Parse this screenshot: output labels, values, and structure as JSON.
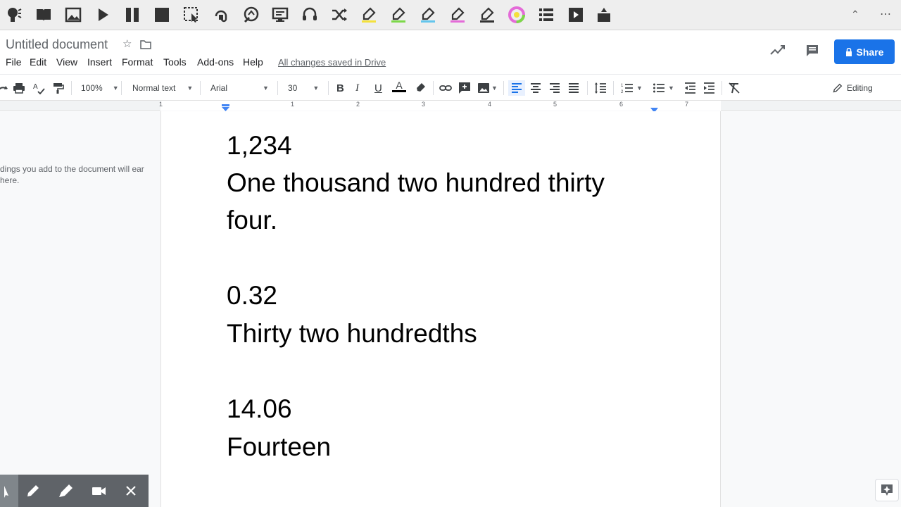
{
  "document": {
    "title": "Untitled document",
    "save_status": "All changes saved in Drive",
    "share_label": "Share",
    "mode_label": "Editing"
  },
  "menu": [
    "File",
    "Edit",
    "View",
    "Insert",
    "Format",
    "Tools",
    "Add-ons",
    "Help"
  ],
  "toolbar": {
    "zoom": "100%",
    "style": "Normal text",
    "font": "Arial",
    "font_size": "30"
  },
  "ruler": [
    "1",
    "1",
    "2",
    "3",
    "4",
    "5",
    "6",
    "7"
  ],
  "outline_hint": "dings you add to the document will ear here.",
  "content": [
    "1,234",
    "One thousand two hundred thirty",
    "four.",
    "0.32",
    "Thirty two hundredths",
    "14.06",
    "Fourteen"
  ],
  "extension_icons": [
    "speak-icon",
    "book-icon",
    "image-icon",
    "play-icon",
    "pause-icon",
    "stop-icon",
    "screenshot-select-icon",
    "listen-icon",
    "translate-icon",
    "screen-icon",
    "headset-icon",
    "shuffle-icon",
    "highlighter-yellow-icon",
    "highlighter-green-icon",
    "highlighter-blue-icon",
    "highlighter-pink-icon",
    "eraser-icon",
    "color-wheel-icon",
    "list-icon",
    "video-icon",
    "export-icon"
  ],
  "colors": {
    "accent": "#1a73e8",
    "highlight_yellow": "#f4e13c",
    "highlight_green": "#7cd849",
    "highlight_blue": "#63c5ec",
    "highlight_pink": "#e46bd8"
  }
}
